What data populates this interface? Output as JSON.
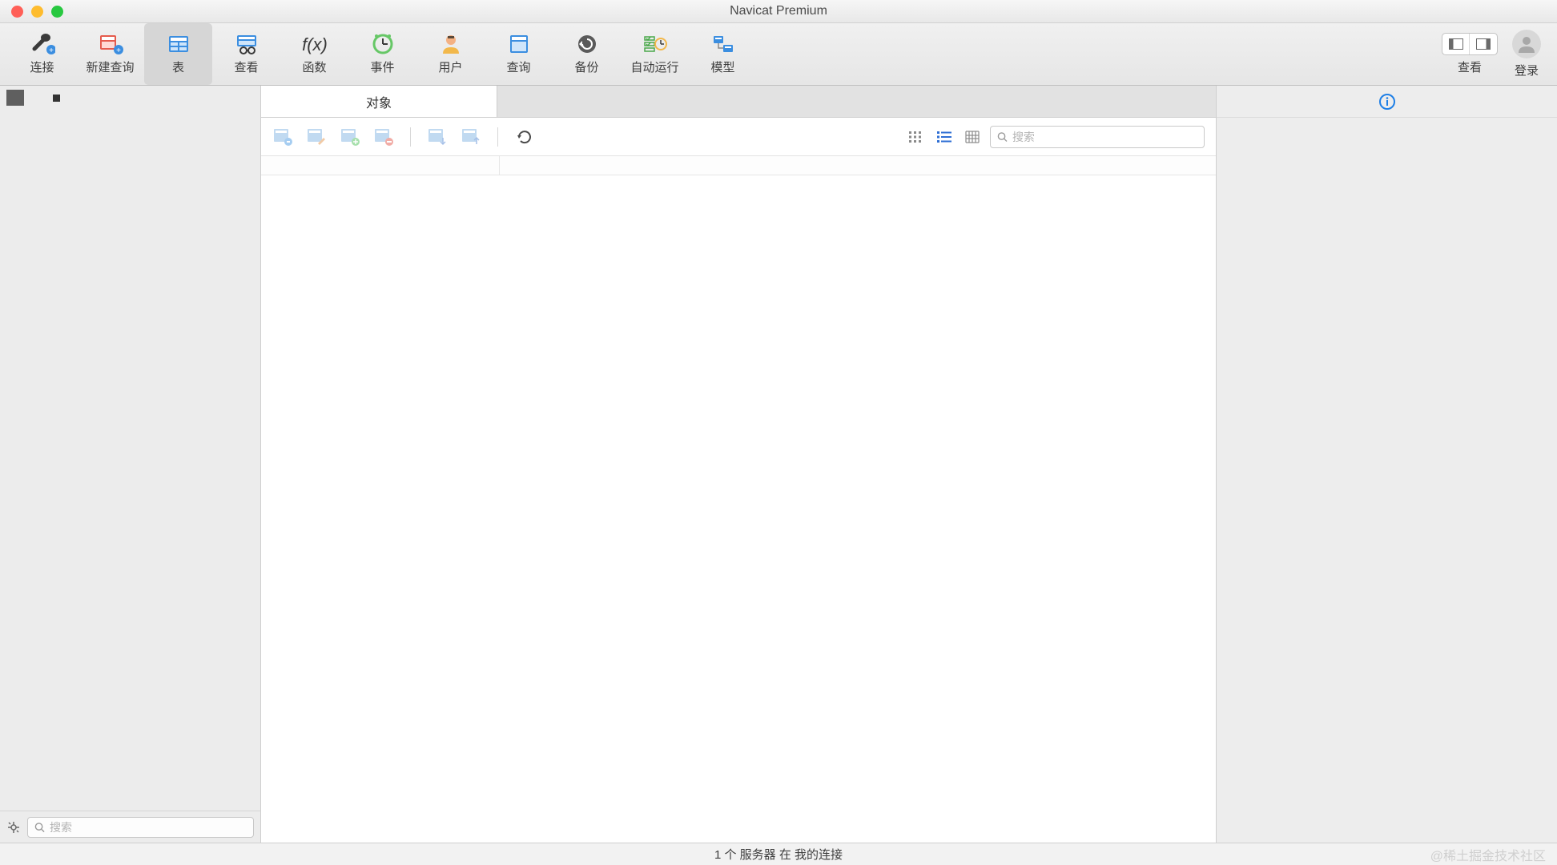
{
  "app": {
    "title": "Navicat Premium"
  },
  "toolbar": {
    "items": [
      {
        "label": "连接"
      },
      {
        "label": "新建查询"
      },
      {
        "label": "表"
      },
      {
        "label": "查看"
      },
      {
        "label": "函数"
      },
      {
        "label": "事件"
      },
      {
        "label": "用户"
      },
      {
        "label": "查询"
      },
      {
        "label": "备份"
      },
      {
        "label": "自动运行"
      },
      {
        "label": "模型"
      }
    ],
    "view_label": "查看",
    "login_label": "登录"
  },
  "sidebar": {
    "search_placeholder": "搜索"
  },
  "main": {
    "tab_label": "对象",
    "search_placeholder": "搜索"
  },
  "status": {
    "text": "1 个 服务器 在 我的连接"
  },
  "watermark": "@稀土掘金技术社区"
}
